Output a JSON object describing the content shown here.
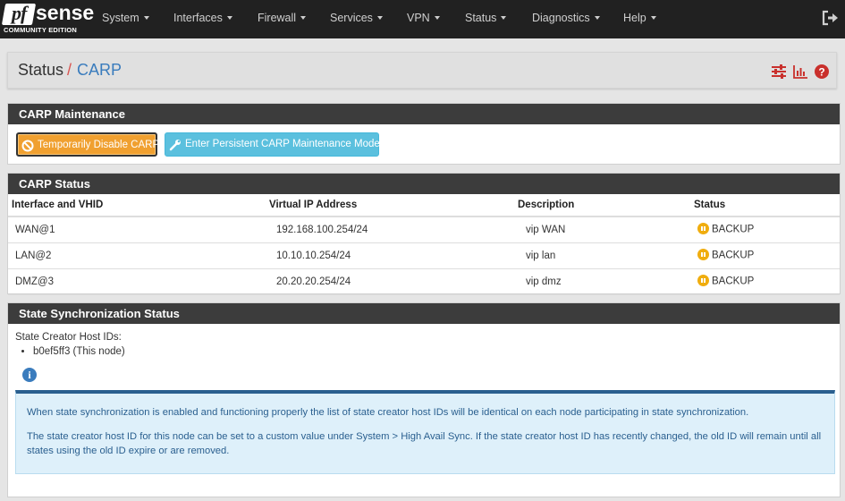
{
  "brand": {
    "name_pf": "pf",
    "name_sense": "sense",
    "edition": "COMMUNITY EDITION"
  },
  "nav": {
    "items": [
      {
        "label": "System"
      },
      {
        "label": "Interfaces"
      },
      {
        "label": "Firewall"
      },
      {
        "label": "Services"
      },
      {
        "label": "VPN"
      },
      {
        "label": "Status"
      },
      {
        "label": "Diagnostics"
      },
      {
        "label": "Help"
      }
    ],
    "logout_icon": "logout-icon"
  },
  "breadcrumb": {
    "parent": "Status",
    "separator": "/",
    "current": "CARP"
  },
  "header_icons": [
    "settings-sliders-icon",
    "bar-chart-icon",
    "help-question-icon"
  ],
  "maintenance": {
    "title": "CARP Maintenance",
    "disable_button": "Temporarily Disable CARP",
    "maintenance_button": "Enter Persistent CARP Maintenance Mode"
  },
  "carp_status": {
    "title": "CARP Status",
    "columns": [
      "Interface and VHID",
      "Virtual IP Address",
      "Description",
      "Status"
    ],
    "rows": [
      {
        "iface": "WAN@1",
        "vip": "192.168.100.254/24",
        "desc": "vip WAN",
        "status": "BACKUP"
      },
      {
        "iface": "LAN@2",
        "vip": "10.10.10.254/24",
        "desc": "vip lan",
        "status": "BACKUP"
      },
      {
        "iface": "DMZ@3",
        "vip": "20.20.20.254/24",
        "desc": "vip dmz",
        "status": "BACKUP"
      }
    ]
  },
  "sync": {
    "title": "State Synchronization Status",
    "creator_label": "State Creator Host IDs:",
    "host_ids": [
      "b0ef5ff3 (This node)"
    ],
    "info_paragraph_1": "When state synchronization is enabled and functioning properly the list of state creator host IDs will be identical on each node participating in state synchronization.",
    "info_paragraph_2": "The state creator host ID for this node can be set to a custom value under System > High Avail Sync. If the state creator host ID has recently changed, the old ID will remain until all states using the old ID expire or are removed."
  },
  "colors": {
    "navbar": "#212121",
    "accent_red": "#d9534f",
    "link_blue": "#3a7cbd",
    "warning": "#f0a030",
    "info": "#5bc0de",
    "backup": "#f0ad0e"
  }
}
